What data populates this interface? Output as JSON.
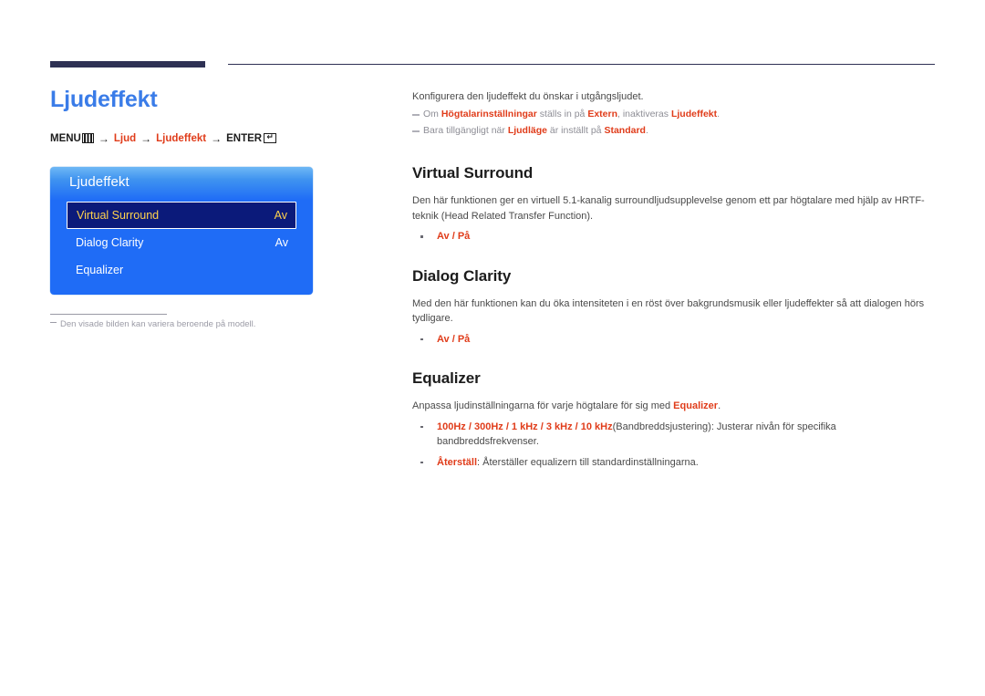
{
  "header": {
    "bar_color": "#2e3154",
    "rule_color": "#2e3154"
  },
  "page": {
    "title": "Ljudeffekt",
    "title_color": "#3a7ce8"
  },
  "breadcrumb": {
    "menu_label": "MENU",
    "menu_icon": "menu-bars-icon",
    "arrow": "→",
    "item1": "Ljud",
    "item2": "Ljudeffekt",
    "enter_label": "ENTER",
    "enter_icon": "enter-return-icon",
    "enter_glyph": "↵",
    "highlight_color": "#e03c1a"
  },
  "osd": {
    "title": "Ljudeffekt",
    "rows": [
      {
        "label": "Virtual Surround",
        "value": "Av",
        "selected": true
      },
      {
        "label": "Dialog Clarity",
        "value": "Av",
        "selected": false
      },
      {
        "label": "Equalizer",
        "value": "",
        "selected": false
      }
    ],
    "background_top": "#6fb8f5",
    "background_main": "#1f6cf6",
    "selected_background": "#0b1a7a",
    "selected_text": "#ffd24d"
  },
  "footnote": {
    "dash": "–",
    "text": "Den visade bilden kan variera beroende på modell."
  },
  "content": {
    "intro": "Konfigurera den ljudeffekt du önskar i utgångsljudet.",
    "notes": [
      {
        "p1": "Om ",
        "b1": "Högtalarinställningar",
        "p2": " ställs in på ",
        "b2": "Extern",
        "p3": ", inaktiveras ",
        "b3": "Ljudeffekt",
        "p4": "."
      },
      {
        "p1": "Bara tillgängligt när ",
        "b1": "Ljudläge",
        "p2": " är inställt på ",
        "b2": "Standard",
        "p3": ".",
        "b3": "",
        "p4": ""
      }
    ],
    "sections": [
      {
        "heading": "Virtual Surround",
        "body": "Den här funktionen ger en virtuell 5.1-kanalig surroundljudsupplevelse genom ett par högtalare med hjälp av HRTF-teknik (Head Related Transfer Function).",
        "bullet_red": "Av / På",
        "bullet_rest": ""
      },
      {
        "heading": "Dialog Clarity",
        "body": "Med den här funktionen kan du öka intensiteten i en röst över bakgrundsmusik eller ljudeffekter så att dialogen hörs tydligare.",
        "bullet_red": "Av / På",
        "bullet_rest": ""
      }
    ],
    "equalizer": {
      "heading": "Equalizer",
      "body_pre": "Anpassa ljudinställningarna för varje högtalare för sig med ",
      "body_red": "Equalizer",
      "body_post": ".",
      "bullets": [
        {
          "red": "100Hz / 300Hz / 1 kHz / 3 kHz / 10 kHz",
          "rest": "(Bandbreddsjustering): Justerar nivån för specifika bandbreddsfrekvenser."
        },
        {
          "red": "Återställ",
          "rest": ": Återställer equalizern till standardinställningarna."
        }
      ]
    }
  }
}
